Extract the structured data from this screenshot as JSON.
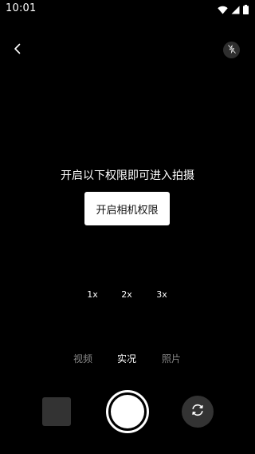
{
  "status_bar": {
    "time": "10:01",
    "icons": [
      "wifi-icon",
      "signal-icon",
      "battery-icon"
    ]
  },
  "top_bar": {
    "back_icon": "chevron-left-icon",
    "flash_icon": "flash-auto-icon"
  },
  "permission": {
    "message": "开启以下权限即可进入拍摄",
    "button_label": "开启相机权限"
  },
  "zoom": {
    "levels": [
      "1x",
      "2x",
      "3x"
    ]
  },
  "modes": {
    "items": [
      "视频",
      "实况",
      "照片"
    ],
    "selected": "实况"
  },
  "bottom": {
    "gallery": "gallery-thumbnail",
    "shutter": "shutter-button",
    "switch_icon": "camera-switch-icon"
  },
  "colors": {
    "background": "#000000",
    "button_bg": "#ffffff",
    "inactive_mode": "#8a8a8a",
    "control_bg": "#333333"
  }
}
